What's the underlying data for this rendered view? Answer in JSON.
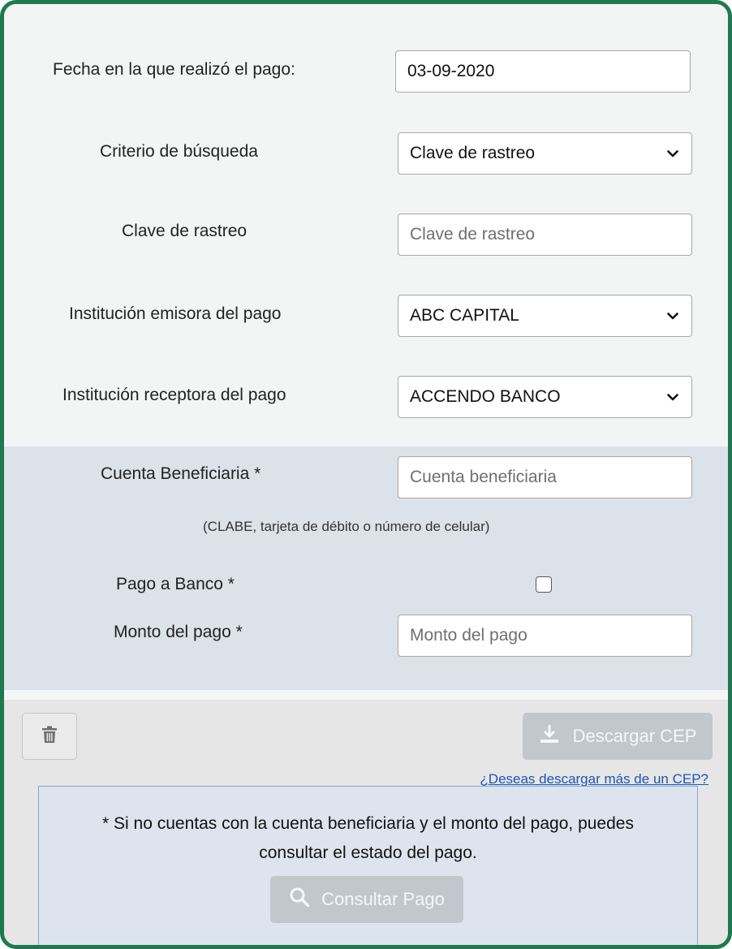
{
  "form": {
    "fecha": {
      "label": "Fecha en la que realizó el pago:",
      "value": "03-09-2020"
    },
    "criterio": {
      "label": "Criterio de búsqueda",
      "selected": "Clave de rastreo"
    },
    "clave": {
      "label": "Clave de rastreo",
      "placeholder": "Clave de rastreo"
    },
    "emisora": {
      "label": "Institución emisora del pago",
      "selected": "ABC CAPITAL"
    },
    "receptora": {
      "label": "Institución receptora del pago",
      "selected": "ACCENDO BANCO"
    },
    "cuenta": {
      "label": "Cuenta Beneficiaria *",
      "placeholder": "Cuenta beneficiaria",
      "hint": "(CLABE, tarjeta de débito o número de celular)"
    },
    "pago_banco": {
      "label": "Pago a Banco *",
      "checked": false
    },
    "monto": {
      "label": "Monto del pago *",
      "placeholder": "Monto del pago"
    }
  },
  "actions": {
    "trash_icon": "trash-icon",
    "descargar_label": "Descargar CEP",
    "descargar_icon": "download-icon",
    "more_link": "¿Deseas descargar más de un CEP?"
  },
  "notice": {
    "line1": "* Si no cuentas con la cuenta beneficiaria y el monto del pago, puedes",
    "line2": "consultar el estado del pago.",
    "consultar_label": "Consultar Pago",
    "consultar_icon": "search-icon"
  },
  "colors": {
    "frame_border": "#1e7a4e",
    "blue_section": "#dce2ea",
    "disabled_button": "#c2c7cc",
    "link": "#1a55b8"
  }
}
